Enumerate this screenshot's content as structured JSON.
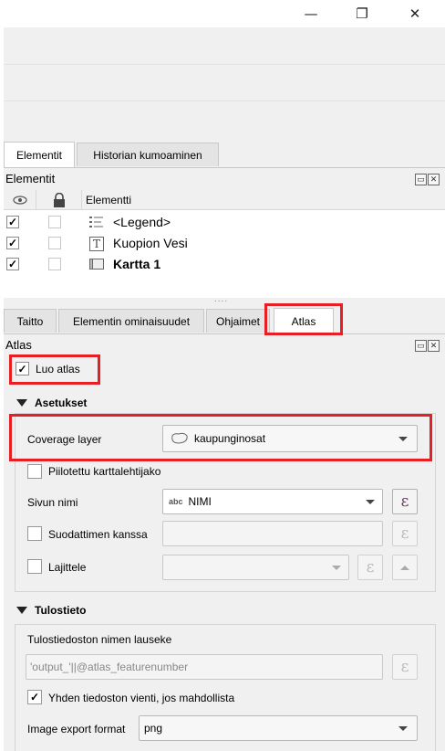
{
  "window": {
    "minimize_glyph": "—",
    "restore_glyph": "❐",
    "close_glyph": "✕"
  },
  "top_tabs": [
    {
      "label": "Elementit"
    },
    {
      "label": "Historian kumoaminen"
    }
  ],
  "elements_panel": {
    "title": "Elementit",
    "column_header": "Elementti",
    "rows": [
      {
        "label": "<Legend>",
        "visible": true,
        "locked": false,
        "icon": "legend-icon",
        "bold": false
      },
      {
        "label": "Kuopion Vesi",
        "visible": true,
        "locked": false,
        "icon": "text-icon",
        "bold": false
      },
      {
        "label": "Kartta 1",
        "visible": true,
        "locked": false,
        "icon": "map-icon",
        "bold": true
      }
    ]
  },
  "splitter_dots": "....",
  "bottom_tabs": [
    {
      "label": "Taitto"
    },
    {
      "label": "Elementin ominaisuudet"
    },
    {
      "label": "Ohjaimet"
    },
    {
      "label": "Atlas"
    }
  ],
  "atlas_panel": {
    "title": "Atlas",
    "generate_atlas": {
      "label": "Luo atlas",
      "checked": true
    },
    "settings": {
      "header": "Asetukset",
      "coverage_layer_label": "Coverage layer",
      "coverage_layer_value": "kaupunginosat",
      "hidden_coverage_label": "Piilotettu karttalehtijako",
      "page_name_label": "Sivun nimi",
      "page_name_prefix": "abc",
      "page_name_value": "NIMI",
      "filter_label": "Suodattimen kanssa",
      "sort_label": "Lajittele"
    },
    "output": {
      "header": "Tulostieto",
      "filename_expr_label": "Tulostiedoston nimen lauseke",
      "filename_expr_value": "'output_'||@atlas_featurenumber",
      "single_file_label": "Yhden tiedoston vienti, jos mahdollista",
      "single_file_checked": true,
      "image_export_label": "Image export format",
      "image_export_value": "png"
    },
    "expression_glyph": "ε"
  },
  "accent_color": "#e81e25"
}
